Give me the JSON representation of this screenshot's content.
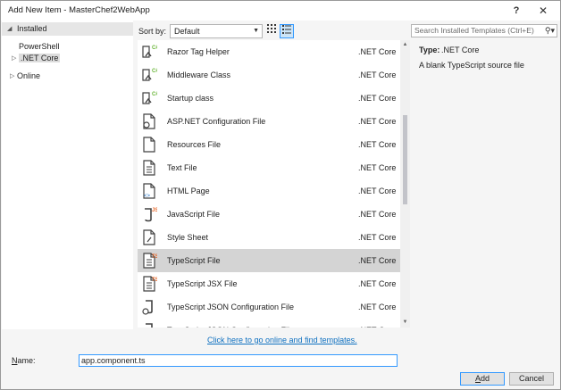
{
  "window": {
    "title": "Add New Item - MasterChef2WebApp",
    "help_glyph": "?",
    "close_glyph": "✕"
  },
  "tree": {
    "installed": "Installed",
    "powershell": "PowerShell",
    "netcore": ".NET Core",
    "online": "Online"
  },
  "toolbar": {
    "sort_label": "Sort by:",
    "sort_value": "Default",
    "views": [
      "grid-view-icon",
      "list-view-icon"
    ]
  },
  "search": {
    "placeholder": "Search Installed Templates (Ctrl+E)"
  },
  "templates": [
    {
      "name": "Razor Tag Helper",
      "category": ".NET Core",
      "icon": "razor-tag-helper-icon"
    },
    {
      "name": "Middleware Class",
      "category": ".NET Core",
      "icon": "middleware-class-icon"
    },
    {
      "name": "Startup class",
      "category": ".NET Core",
      "icon": "startup-class-icon"
    },
    {
      "name": "ASP.NET Configuration File",
      "category": ".NET Core",
      "icon": "config-file-icon"
    },
    {
      "name": "Resources File",
      "category": ".NET Core",
      "icon": "resources-file-icon"
    },
    {
      "name": "Text File",
      "category": ".NET Core",
      "icon": "text-file-icon"
    },
    {
      "name": "HTML Page",
      "category": ".NET Core",
      "icon": "html-page-icon"
    },
    {
      "name": "JavaScript File",
      "category": ".NET Core",
      "icon": "javascript-file-icon"
    },
    {
      "name": "Style Sheet",
      "category": ".NET Core",
      "icon": "style-sheet-icon"
    },
    {
      "name": "TypeScript File",
      "category": ".NET Core",
      "icon": "typescript-file-icon"
    },
    {
      "name": "TypeScript JSX File",
      "category": ".NET Core",
      "icon": "typescript-jsx-file-icon"
    },
    {
      "name": "TypeScript JSON Configuration File",
      "category": ".NET Core",
      "icon": "json-config-file-icon"
    },
    {
      "name": "TypeScript JSON Configuration File",
      "category": ".NET Core",
      "icon": "json-config-file-icon"
    }
  ],
  "selected_index": 9,
  "details": {
    "type_label": "Type:",
    "type_value": ".NET Core",
    "description": "A blank TypeScript source file"
  },
  "online_link": "Click here to go online and find templates.",
  "name_field": {
    "label": "Name:",
    "value": "app.component.ts"
  },
  "buttons": {
    "add": "Add",
    "cancel": "Cancel"
  },
  "colors": {
    "selection": "#d4d4d4",
    "accent": "#3399ff",
    "link": "#0e70c0",
    "ts_badge": "#e8682a",
    "csharp_badge": "#68b536"
  }
}
